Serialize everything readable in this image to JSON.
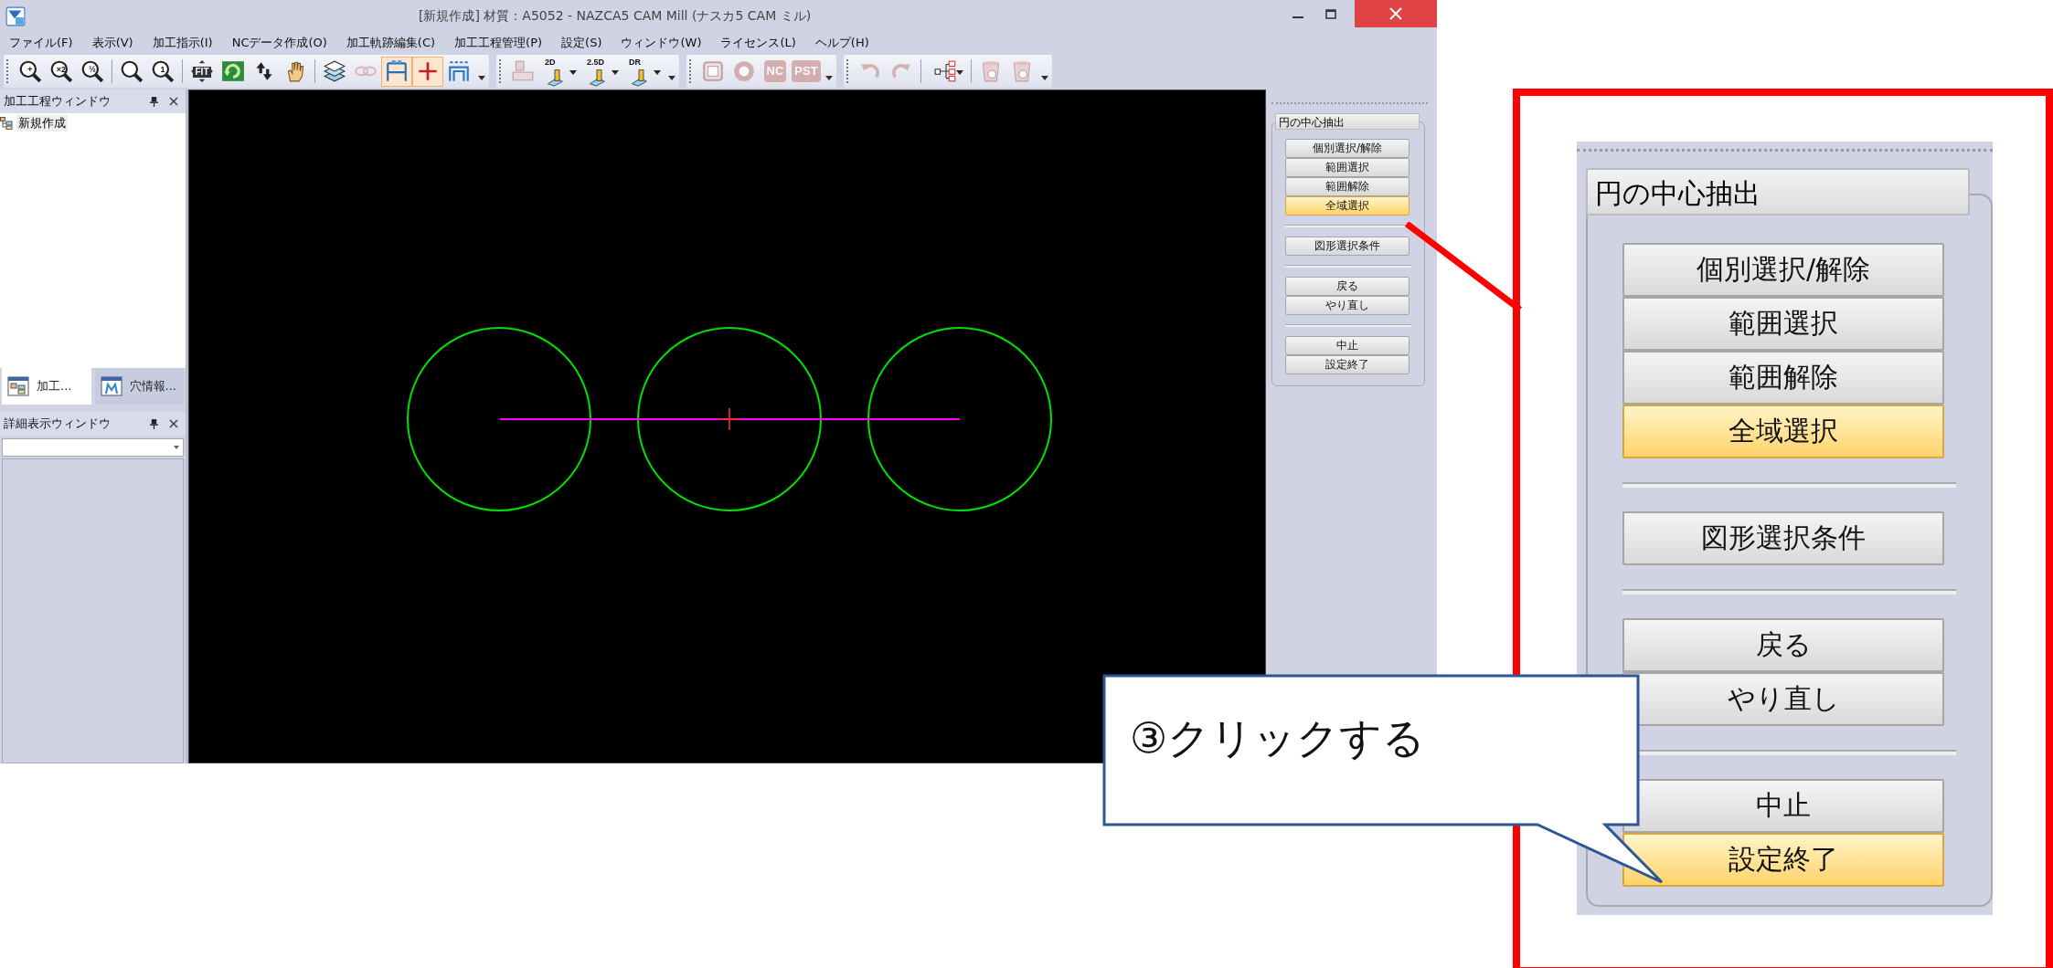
{
  "window": {
    "title": "[新規作成] 材質：A5052 - NAZCA5 CAM Mill (ナスカ5 CAM ミル)"
  },
  "menu": [
    "ファイル(F)",
    "表示(V)",
    "加工指示(I)",
    "NCデータ作成(O)",
    "加工軌跡編集(C)",
    "加工工程管理(P)",
    "設定(S)",
    "ウィンドウ(W)",
    "ライセンス(L)",
    "ヘルプ(H)"
  ],
  "toolbars": [
    {
      "items": [
        {
          "kind": "zoom",
          "label": "+",
          "selected": false,
          "disabled": false
        },
        {
          "kind": "zoom",
          "label": "×2",
          "selected": false,
          "disabled": false
        },
        {
          "kind": "zoom",
          "label": "½",
          "selected": false,
          "disabled": false
        },
        {
          "kind": "sep"
        },
        {
          "kind": "zoom",
          "selected": false,
          "disabled": false
        },
        {
          "kind": "zoom",
          "label": "1",
          "selected": false,
          "disabled": false
        },
        {
          "kind": "sep"
        },
        {
          "kind": "fit",
          "label": "FIT",
          "selected": false,
          "disabled": false
        },
        {
          "kind": "refresh",
          "selected": false,
          "disabled": false
        },
        {
          "kind": "swap",
          "selected": false,
          "disabled": false
        },
        {
          "kind": "hand",
          "selected": false,
          "disabled": false
        },
        {
          "kind": "sep"
        },
        {
          "kind": "layers",
          "selected": false,
          "disabled": false
        },
        {
          "kind": "chain",
          "selected": false,
          "disabled": true
        },
        {
          "kind": "dimension",
          "selected": true,
          "disabled": false
        },
        {
          "kind": "cross",
          "selected": true,
          "disabled": false
        },
        {
          "kind": "dimension2",
          "selected": false,
          "disabled": false
        }
      ]
    },
    {
      "items": [
        {
          "kind": "machine",
          "selected": false,
          "disabled": true
        },
        {
          "kind": "tool",
          "label": "2D",
          "selected": false,
          "disabled": false
        },
        {
          "kind": "tool",
          "label": "2.5D",
          "selected": false,
          "disabled": false
        },
        {
          "kind": "tool",
          "label": "DR",
          "selected": false,
          "disabled": false
        }
      ]
    },
    {
      "items": [
        {
          "kind": "frame",
          "selected": false,
          "disabled": true
        },
        {
          "kind": "wheel",
          "selected": false,
          "disabled": true
        },
        {
          "kind": "badge",
          "label": "NC",
          "selected": false,
          "disabled": true
        },
        {
          "kind": "badge",
          "label": "PST",
          "selected": false,
          "disabled": true
        }
      ]
    },
    {
      "items": [
        {
          "kind": "undo",
          "selected": false,
          "disabled": true
        },
        {
          "kind": "redo",
          "selected": false,
          "disabled": true
        },
        {
          "kind": "sep"
        },
        {
          "kind": "tree",
          "selected": false,
          "disabled": false
        },
        {
          "kind": "sep"
        },
        {
          "kind": "trash",
          "selected": false,
          "disabled": true
        },
        {
          "kind": "trash2",
          "selected": false,
          "disabled": true
        }
      ]
    }
  ],
  "process_window": {
    "title": "加工工程ウィンドウ",
    "tree": [
      "新規作成"
    ],
    "tabs": [
      {
        "label": "加工...",
        "selected": true
      },
      {
        "label": "穴情報...",
        "selected": false
      }
    ]
  },
  "detail_window": {
    "title": "詳細表示ウィンドウ"
  },
  "task_panel": {
    "title": "円の中心抽出",
    "groups": [
      [
        {
          "label": "個別選択/解除",
          "selected": false
        },
        {
          "label": "範囲選択",
          "selected": false
        },
        {
          "label": "範囲解除",
          "selected": false
        },
        {
          "label": "全域選択",
          "selected": true
        }
      ],
      [
        {
          "label": "図形選択条件",
          "selected": false
        }
      ],
      [
        {
          "label": "戻る",
          "selected": false
        },
        {
          "label": "やり直し",
          "selected": false
        }
      ],
      [
        {
          "label": "中止",
          "selected": false
        },
        {
          "label": "設定終了",
          "selected": false
        }
      ]
    ]
  },
  "zoom_panel": {
    "title": "円の中心抽出",
    "groups": [
      [
        {
          "label": "個別選択/解除",
          "selected": false
        },
        {
          "label": "範囲選択",
          "selected": false
        },
        {
          "label": "範囲解除",
          "selected": false
        },
        {
          "label": "全域選択",
          "selected": true
        }
      ],
      [
        {
          "label": "図形選択条件",
          "selected": false
        }
      ],
      [
        {
          "label": "戻る",
          "selected": false
        },
        {
          "label": "やり直し",
          "selected": false
        }
      ],
      [
        {
          "label": "中止",
          "selected": false
        },
        {
          "label": "設定終了",
          "selected": true
        }
      ]
    ]
  },
  "callout": {
    "text": "③クリックする"
  }
}
